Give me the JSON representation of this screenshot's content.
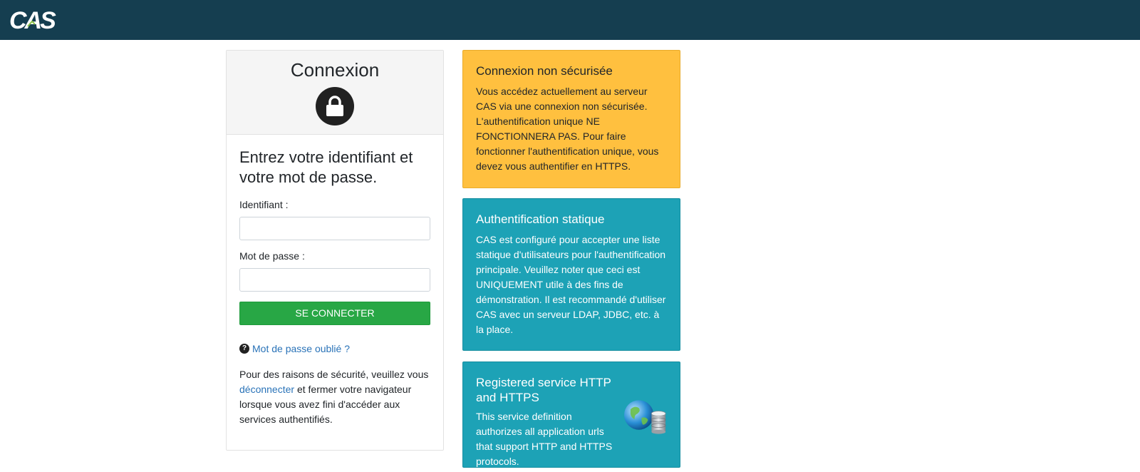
{
  "brand": {
    "logo_text": "CAS",
    "colors": {
      "header": "#153e50",
      "success": "#28a745",
      "warning": "#ffc03f",
      "info": "#1da2b6",
      "link": "#2a73b8"
    }
  },
  "login": {
    "title": "Connexion",
    "lock_icon": "lock-icon",
    "heading": "Entrez votre identifiant et votre mot de passe.",
    "username_label": "Identifiant :",
    "username_value": "",
    "password_label": "Mot de passe :",
    "password_value": "",
    "submit_label": "SE CONNECTER",
    "forgot_icon": "question-circle-icon",
    "forgot_label": "Mot de passe oublié ?",
    "security_before": "Pour des raisons de sécurité, veuillez vous ",
    "security_link": "déconnecter",
    "security_after": " et fermer votre navigateur lorsque vous avez fini d'accéder aux services authentifiés."
  },
  "notices": {
    "insecure": {
      "title": "Connexion non sécurisée",
      "text": "Vous accédez actuellement au serveur CAS via une connexion non sécurisée. L'authentification unique NE FONCTIONNERA PAS. Pour faire fonctionner l'authentification unique, vous devez vous authentifier en HTTPS."
    },
    "static_auth": {
      "title": "Authentification statique",
      "text": "CAS est configuré pour accepter une liste statique d'utilisateurs pour l'authentification principale. Veuillez noter que ceci est UNIQUEMENT utile à des fins de démonstration. Il est recommandé d'utiliser CAS avec un serveur LDAP, JDBC, etc. à la place."
    },
    "service": {
      "title": "Registered service HTTP and HTTPS",
      "text": "This service definition authorizes all application urls that support HTTP and HTTPS protocols.",
      "logo_icon": "globe-database-icon"
    }
  }
}
